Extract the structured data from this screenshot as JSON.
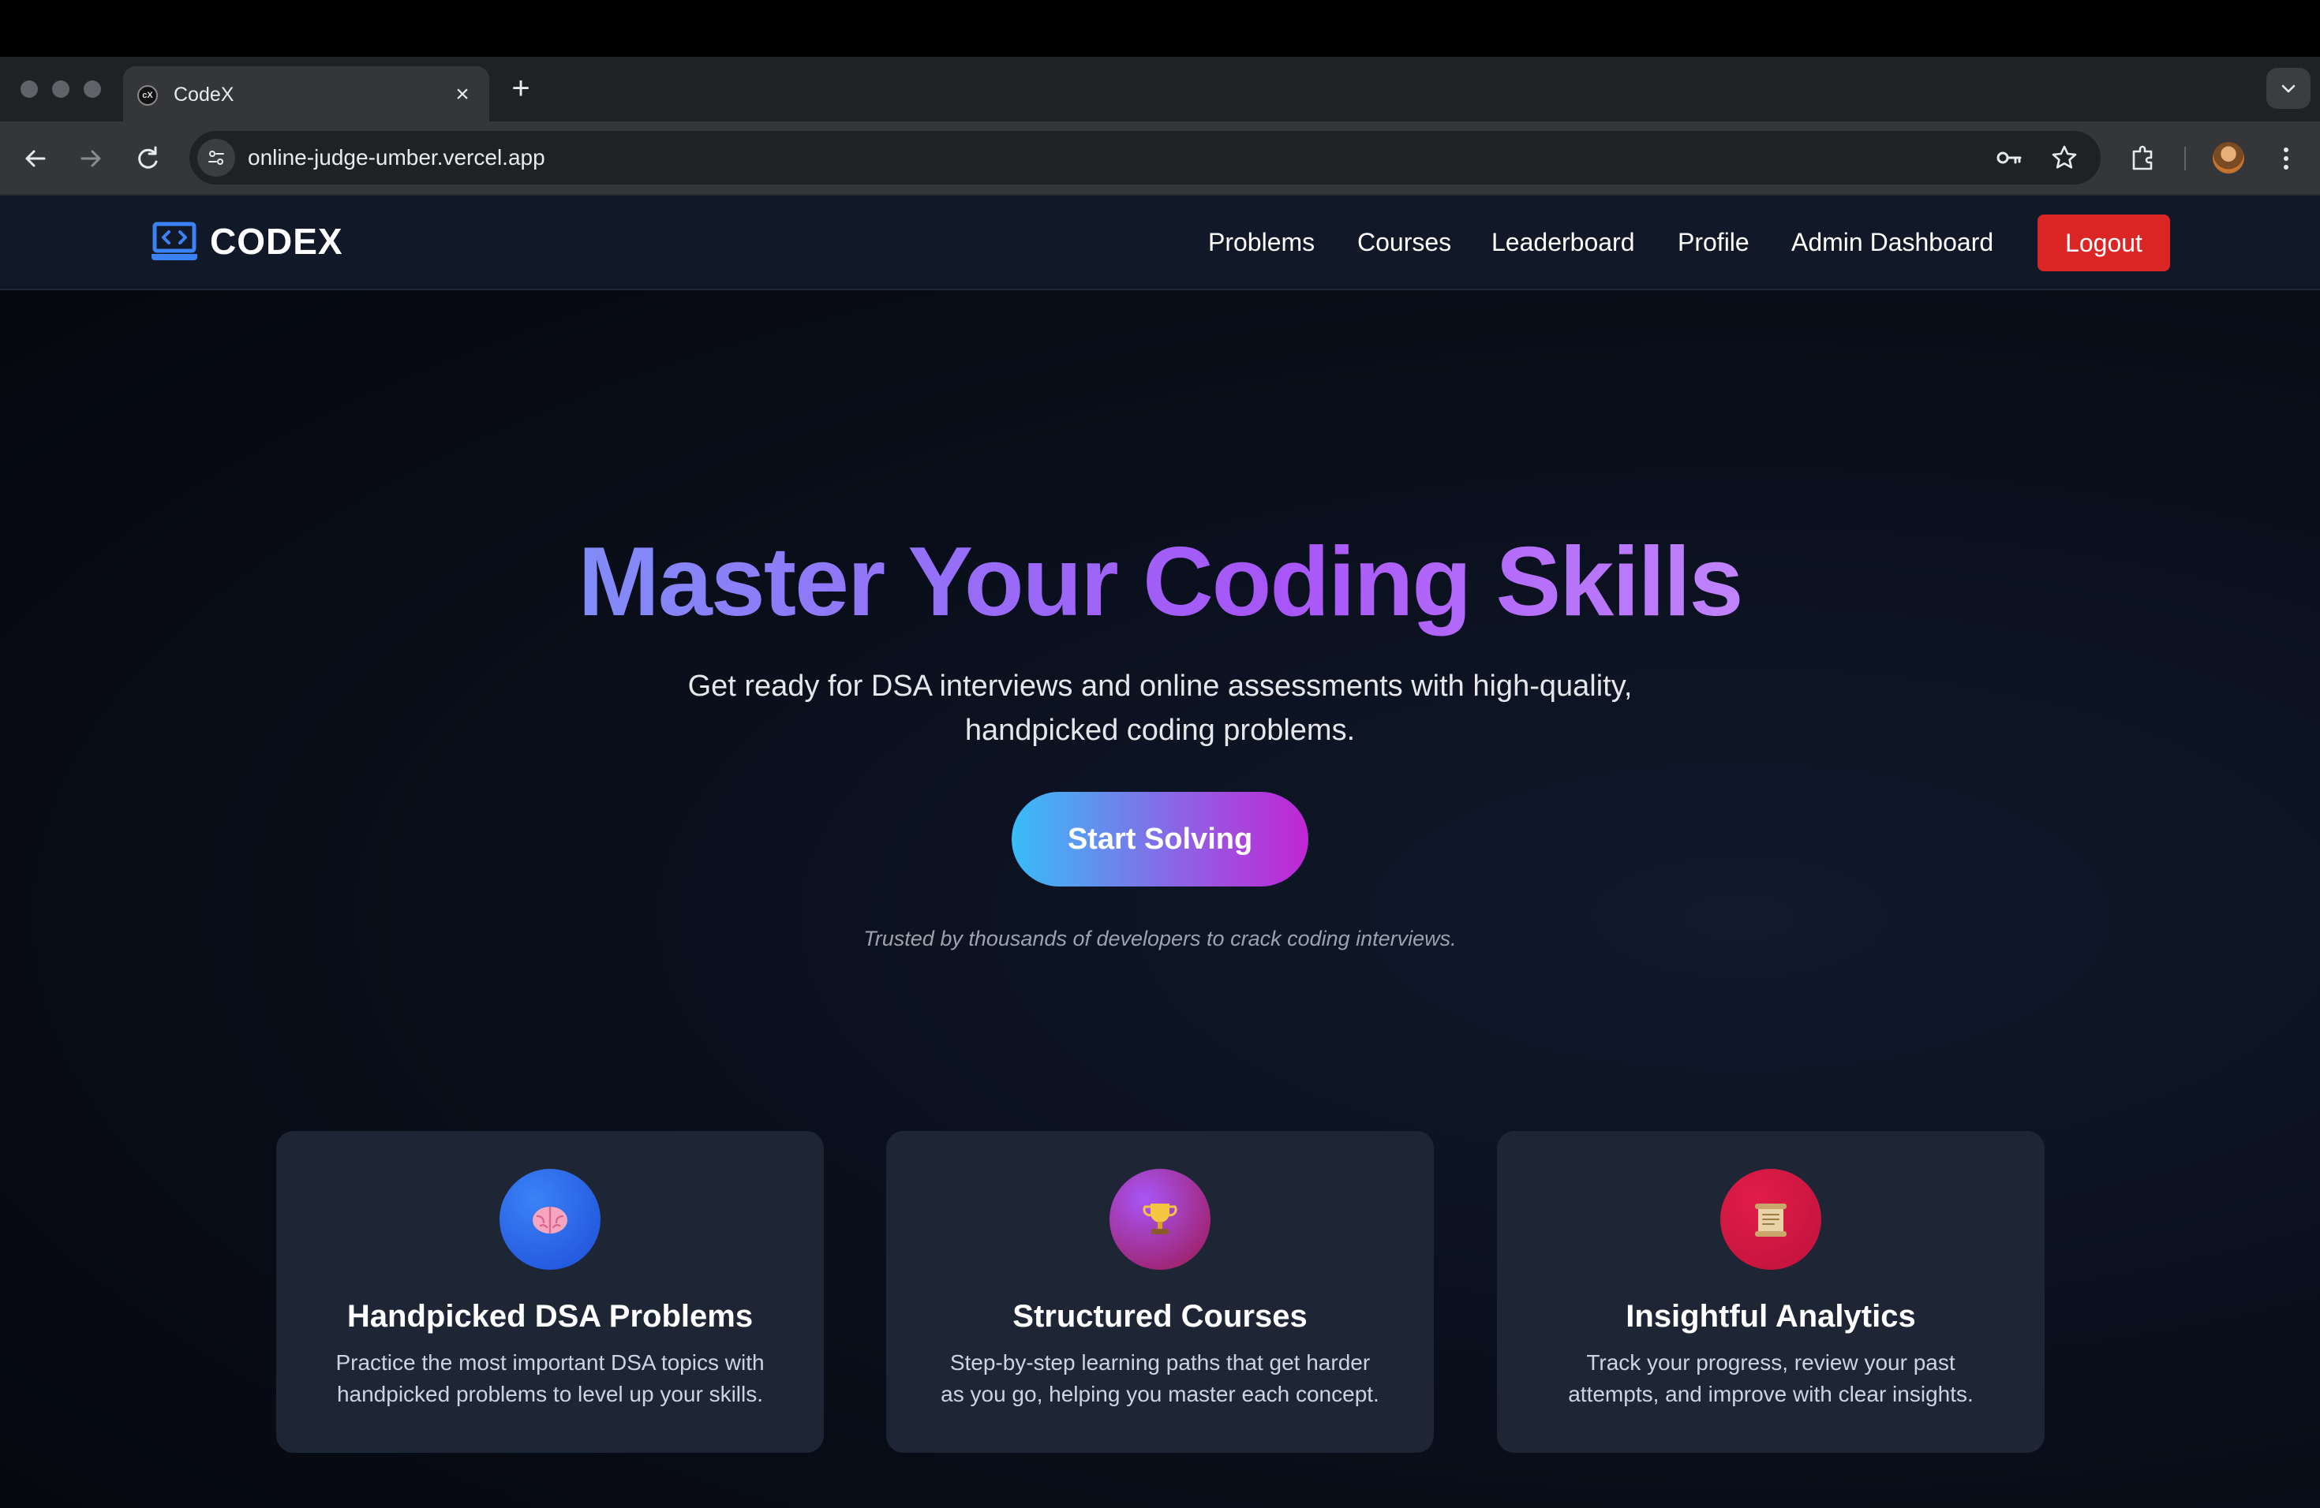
{
  "browser": {
    "tab_title": "CodeX",
    "url": "online-judge-umber.vercel.app"
  },
  "site": {
    "logo_text": "CODEX",
    "nav": {
      "problems": "Problems",
      "courses": "Courses",
      "leaderboard": "Leaderboard",
      "profile": "Profile",
      "admin_dashboard": "Admin Dashboard",
      "logout": "Logout"
    },
    "hero": {
      "title": "Master Your Coding Skills",
      "subtitle_line1": "Get ready for DSA interviews and online assessments with high-quality,",
      "subtitle_line2": "handpicked coding problems.",
      "cta": "Start Solving",
      "trusted": "Trusted by thousands of developers to crack coding interviews."
    },
    "features": [
      {
        "icon": "brain-icon",
        "title": "Handpicked DSA Problems",
        "desc_line1": "Practice the most important DSA topics with",
        "desc_line2": "handpicked problems to level up your skills."
      },
      {
        "icon": "trophy-icon",
        "title": "Structured Courses",
        "desc_line1": "Step-by-step learning paths that get harder",
        "desc_line2": "as you go, helping you master each concept."
      },
      {
        "icon": "scroll-icon",
        "title": "Insightful Analytics",
        "desc_line1": "Track your progress, review your past",
        "desc_line2": "attempts, and improve with clear insights."
      }
    ]
  },
  "colors": {
    "accent_gradient_start": "#818cf8",
    "accent_gradient_end": "#c084fc",
    "logout_red": "#dc2626",
    "card_bg": "#1e2636",
    "nav_bg": "#111827"
  }
}
